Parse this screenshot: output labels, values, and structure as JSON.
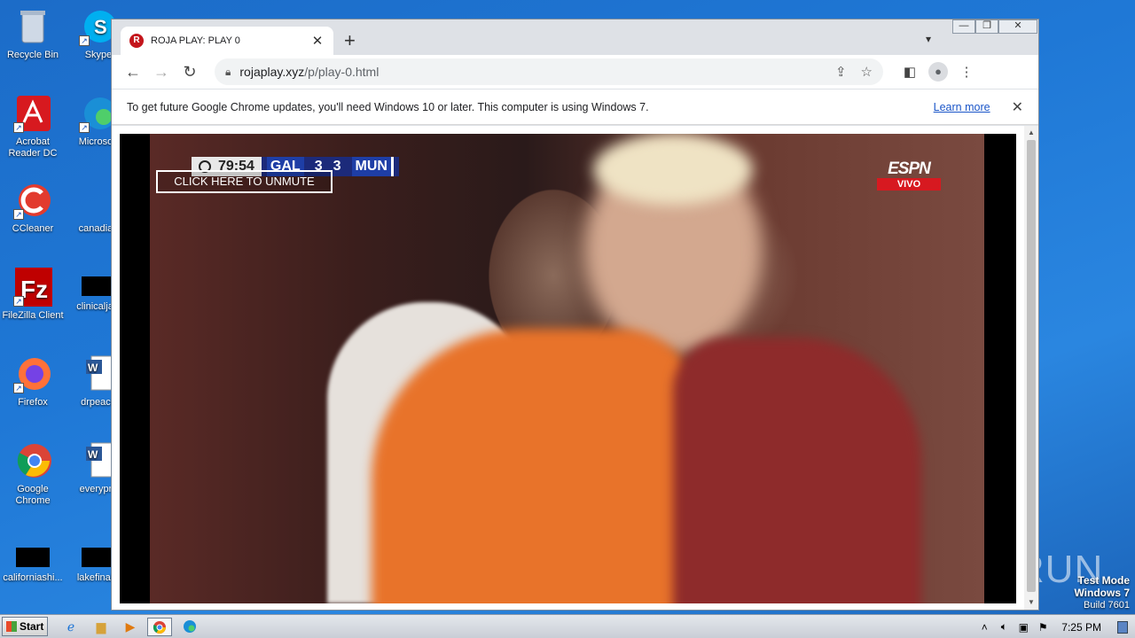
{
  "desktop": {
    "icons": [
      {
        "label": "Recycle Bin"
      },
      {
        "label": "Skype"
      },
      {
        "label": "Acrobat Reader DC"
      },
      {
        "label": "Microsoft"
      },
      {
        "label": "CCleaner"
      },
      {
        "label": "canadian"
      },
      {
        "label": "FileZilla Client"
      },
      {
        "label": "clinicaljacl"
      },
      {
        "label": "Firefox"
      },
      {
        "label": "drpeace"
      },
      {
        "label": "Google Chrome"
      },
      {
        "label": "everypre"
      },
      {
        "label": "californiashi..."
      },
      {
        "label": "lakefinally"
      }
    ]
  },
  "browser": {
    "tab": {
      "title": "ROJA PLAY: PLAY 0",
      "favicon_letter": "R"
    },
    "url": {
      "host": "rojaplay.xyz",
      "path": "/p/play-0.html"
    },
    "infobar": {
      "message": "To get future Google Chrome updates, you'll need Windows 10 or later. This computer is using Windows 7.",
      "link": "Learn more"
    }
  },
  "video": {
    "scorebug": {
      "clock": "79:54",
      "home": "GAL",
      "home_score": "3",
      "away_score": "3",
      "away": "MUN"
    },
    "unmute_label": "CLICK HERE TO UNMUTE",
    "broadcaster": "ESPN",
    "broadcaster_tag": "VIVO"
  },
  "watermark": "ANY RUN",
  "os": {
    "test_mode": "Test Mode",
    "version": "Windows 7",
    "build": "Build 7601",
    "start_label": "Start",
    "clock": "7:25 PM"
  }
}
